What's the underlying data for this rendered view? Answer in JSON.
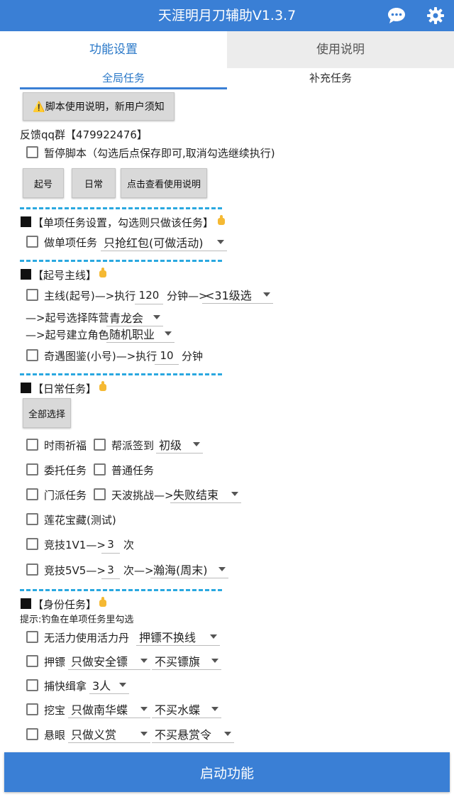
{
  "app": {
    "title": "天涯明月刀辅助V1.3.7"
  },
  "tabs": {
    "settings": "功能设置",
    "help": "使用说明"
  },
  "subtabs": {
    "global": "全局任务",
    "extra": "补充任务"
  },
  "top": {
    "notice_button": "⚠️脚本使用说明，新用户须知",
    "qq_group": "反馈qq群【479922476】",
    "pause_label": "暂停脚本（勾选后点保存即可,取消勾选继续执行)",
    "btn_qihao": "起号",
    "btn_richang": "日常",
    "btn_help": "点击查看使用说明"
  },
  "single": {
    "header": "【单项任务设置，勾选则只做该任务】",
    "label": "做单项任务",
    "select": "只抢红包(可做活动)"
  },
  "qihao": {
    "header": "【起号主线】",
    "main_label": "主线(起号)—>执行",
    "main_minutes": "120",
    "main_unit": "分钟—>",
    "main_level": "<31级选",
    "camp_label": "—>起号选择阵营",
    "camp_value": "青龙会",
    "role_label": "—>起号建立角色",
    "role_value": "随机职业",
    "qiyu_label": "奇遇图鉴(小号)—>执行",
    "qiyu_minutes": "10",
    "qiyu_unit": "分钟"
  },
  "daily": {
    "header": "【日常任务】",
    "select_all": "全部选择",
    "shiyu": "时雨祈福",
    "bangpai": "帮派签到",
    "bangpai_level": "初级",
    "weituo": "委托任务",
    "putong": "普通任务",
    "menpai": "门派任务",
    "tianbo": "天波挑战—>",
    "tianbo_value": "失败结束",
    "lianhua": "莲花宝藏(测试)",
    "jingji1": "竞技1V1—>",
    "jingji1_count": "3",
    "jingji1_unit": "次",
    "jingji5": "竞技5V5—>",
    "jingji5_count": "3",
    "jingji5_unit": "次—>",
    "jingji5_map": "瀚海(周末)"
  },
  "identity": {
    "header": "【身份任务】",
    "tip": "提示:钓鱼在单项任务里勾选",
    "wuhuoli": "无活力使用活力丹",
    "wuhuoli_value": "押镖不换线",
    "yabiao": "押镖",
    "yabiao_v1": "只做安全镖",
    "yabiao_v2": "不买镖旗",
    "buzhuo": "捕快缉拿",
    "buzhuo_value": "3人",
    "wabao": "挖宝",
    "wabao_v1": "只做南华蝶",
    "wabao_v2": "不买水蝶",
    "xuanyan": "悬眼",
    "xuanyan_v1": "只做义赏",
    "xuanyan_v2": "不买悬赏令"
  },
  "start_button": "启动功能",
  "colors": {
    "primary": "#3a7fd5",
    "divider": "#2aa8e0",
    "hand": "#f5b933"
  },
  "icons": [
    "chat-icon",
    "gear-icon",
    "pointing-hand-icon",
    "warning-icon"
  ]
}
